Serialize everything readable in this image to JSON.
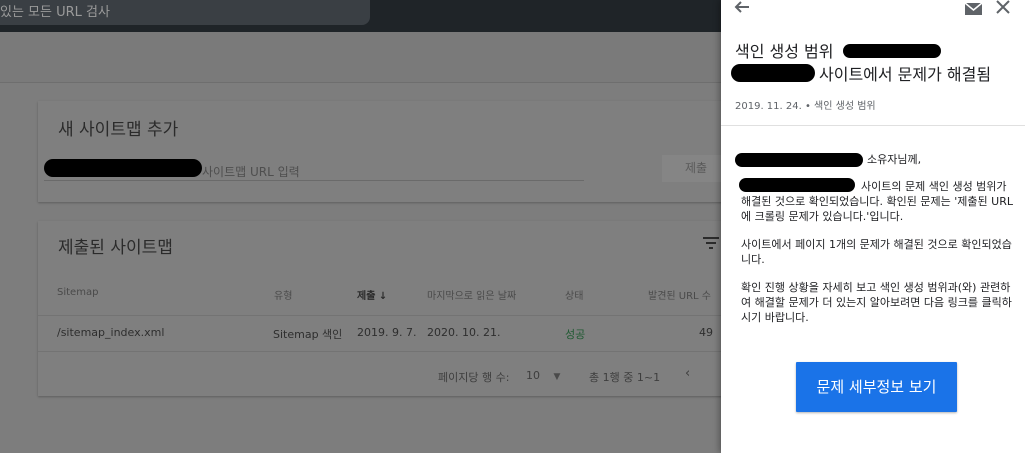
{
  "background": {
    "search_placeholder": "있는 모든 URL 검사",
    "add_sitemap": {
      "title": "새 사이트맵 추가",
      "input_placeholder": "사이트맵 URL 입력",
      "submit_label": "제출"
    },
    "submitted": {
      "title": "제출된 사이트맵",
      "columns": [
        "Sitemap",
        "유형",
        "제출",
        "마지막으로 읽은 날짜",
        "상태",
        "발견된 URL 수"
      ],
      "rows": [
        {
          "sitemap": "/sitemap_index.xml",
          "type": "Sitemap 색인",
          "submitted": "2019. 9. 7.",
          "last_read": "2020. 10. 21.",
          "status": "성공",
          "urls": "49"
        }
      ],
      "rows_per_page_label": "페이지당 행 수:",
      "rows_per_page_value": "10",
      "pagination": "총 1행 중 1~1"
    }
  },
  "panel": {
    "title_part1": "색인 생성 범위",
    "title_part2": "사이트에서 문제가 해결됨",
    "meta": "2019. 11. 24. • 색인 생성 범위",
    "greeting_suffix": "소유자님께,",
    "para1": "사이트의 문제 색인 생성 범위가 해결된 것으로 확인되었습니다. 확인된 문제는 '제출된 URL에 크롤링 문제가 있습니다.'입니다.",
    "para2": "사이트에서 페이지 1개의 문제가 해결된 것으로 확인되었습니다.",
    "para3": "확인 진행 상황을 자세히 보고 색인 생성 범위과(와) 관련하여 해결할 문제가 더 있는지 알아보려면 다음 링크를 클릭하시기 바랍니다.",
    "cta_label": "문제 세부정보 보기"
  },
  "colors": {
    "accent": "#1a73e8",
    "success": "#1f5a32"
  }
}
